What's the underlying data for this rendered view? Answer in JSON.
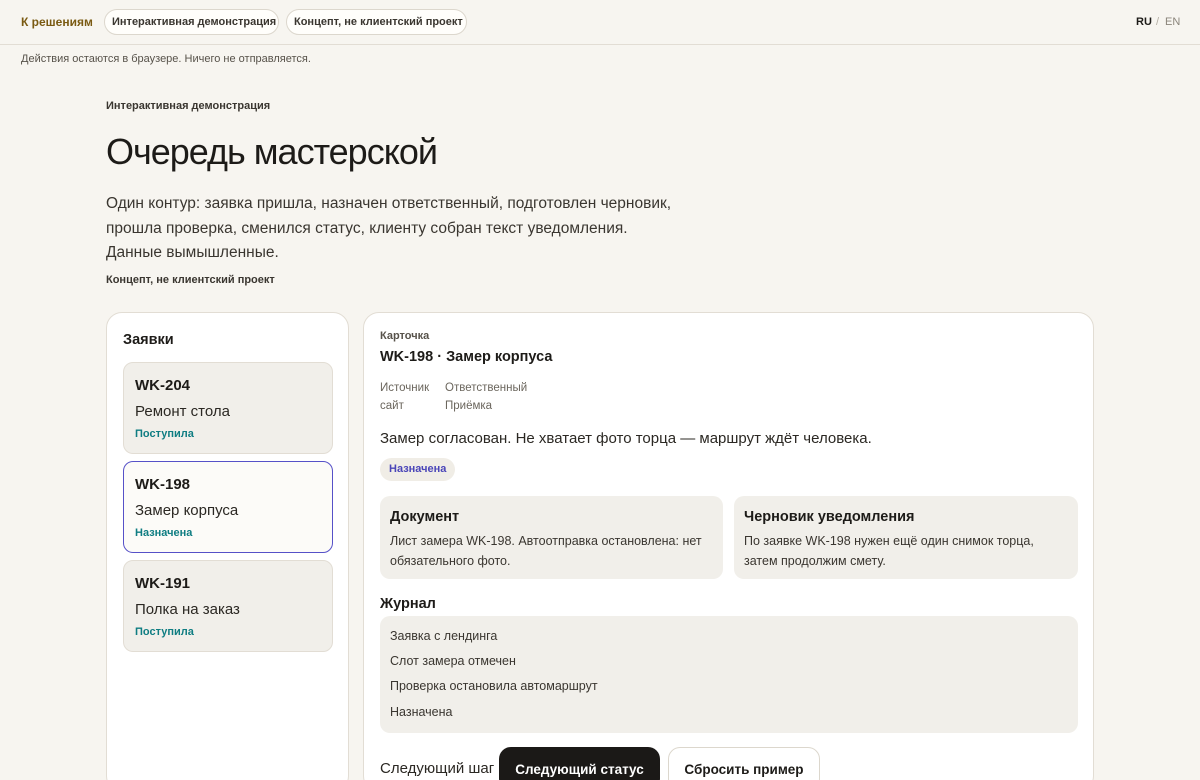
{
  "topbar": {
    "back_label": "К решениям",
    "pill_demo": "Интерактивная демонстрация",
    "pill_concept": "Концепт, не клиентский проект",
    "lang_ru": "RU",
    "lang_sep": "/",
    "lang_en": "EN"
  },
  "notice": "Действия остаются в браузере. Ничего не отправляется.",
  "hero": {
    "eyebrow": "Интерактивная демонстрация",
    "title": "Очередь мастерской",
    "lead_lines": [
      "Один контур: заявка пришла, назначен ответственный, подготовлен черновик,",
      "прошла проверка, сменился статус, клиенту собран текст уведомления.",
      "Данные вымышленные."
    ],
    "concept_note": "Концепт, не клиентский проект"
  },
  "requests": {
    "title": "Заявки",
    "items": [
      {
        "id": "WK-204",
        "name": "Ремонт стола",
        "status": "Поступила"
      },
      {
        "id": "WK-198",
        "name": "Замер корпуса",
        "status": "Назначена"
      },
      {
        "id": "WK-191",
        "name": "Полка на заказ",
        "status": "Поступила"
      }
    ]
  },
  "card": {
    "eyebrow": "Карточка",
    "title": "WK-198 · Замер корпуса",
    "source_label": "Источник",
    "source_value": "сайт",
    "owner_label": "Ответственный",
    "owner_value": "Приёмка",
    "summary": "Замер согласован. Не хватает фото торца — маршрут ждёт человека.",
    "status": "Назначена",
    "document": {
      "title": "Документ",
      "text": "Лист замера WK-198. Автоотправка остановлена: нет обязательного фото."
    },
    "draft": {
      "title": "Черновик уведомления",
      "text": "По заявке WK-198 нужен ещё один снимок торца, затем продолжим смету."
    },
    "journal_title": "Журнал",
    "journal": [
      "Заявка с лендинга",
      "Слот замера отмечен",
      "Проверка остановила автомаршрут",
      "Назначена"
    ],
    "next_label": "Следующий шаг",
    "next_button": "Следующий статус",
    "reset_button": "Сбросить пример"
  },
  "colors": {
    "accent_brown": "#7a5a12",
    "status_teal": "#0f7d82",
    "status_indigo": "#4a45b8",
    "selected_border": "#5651c8"
  }
}
